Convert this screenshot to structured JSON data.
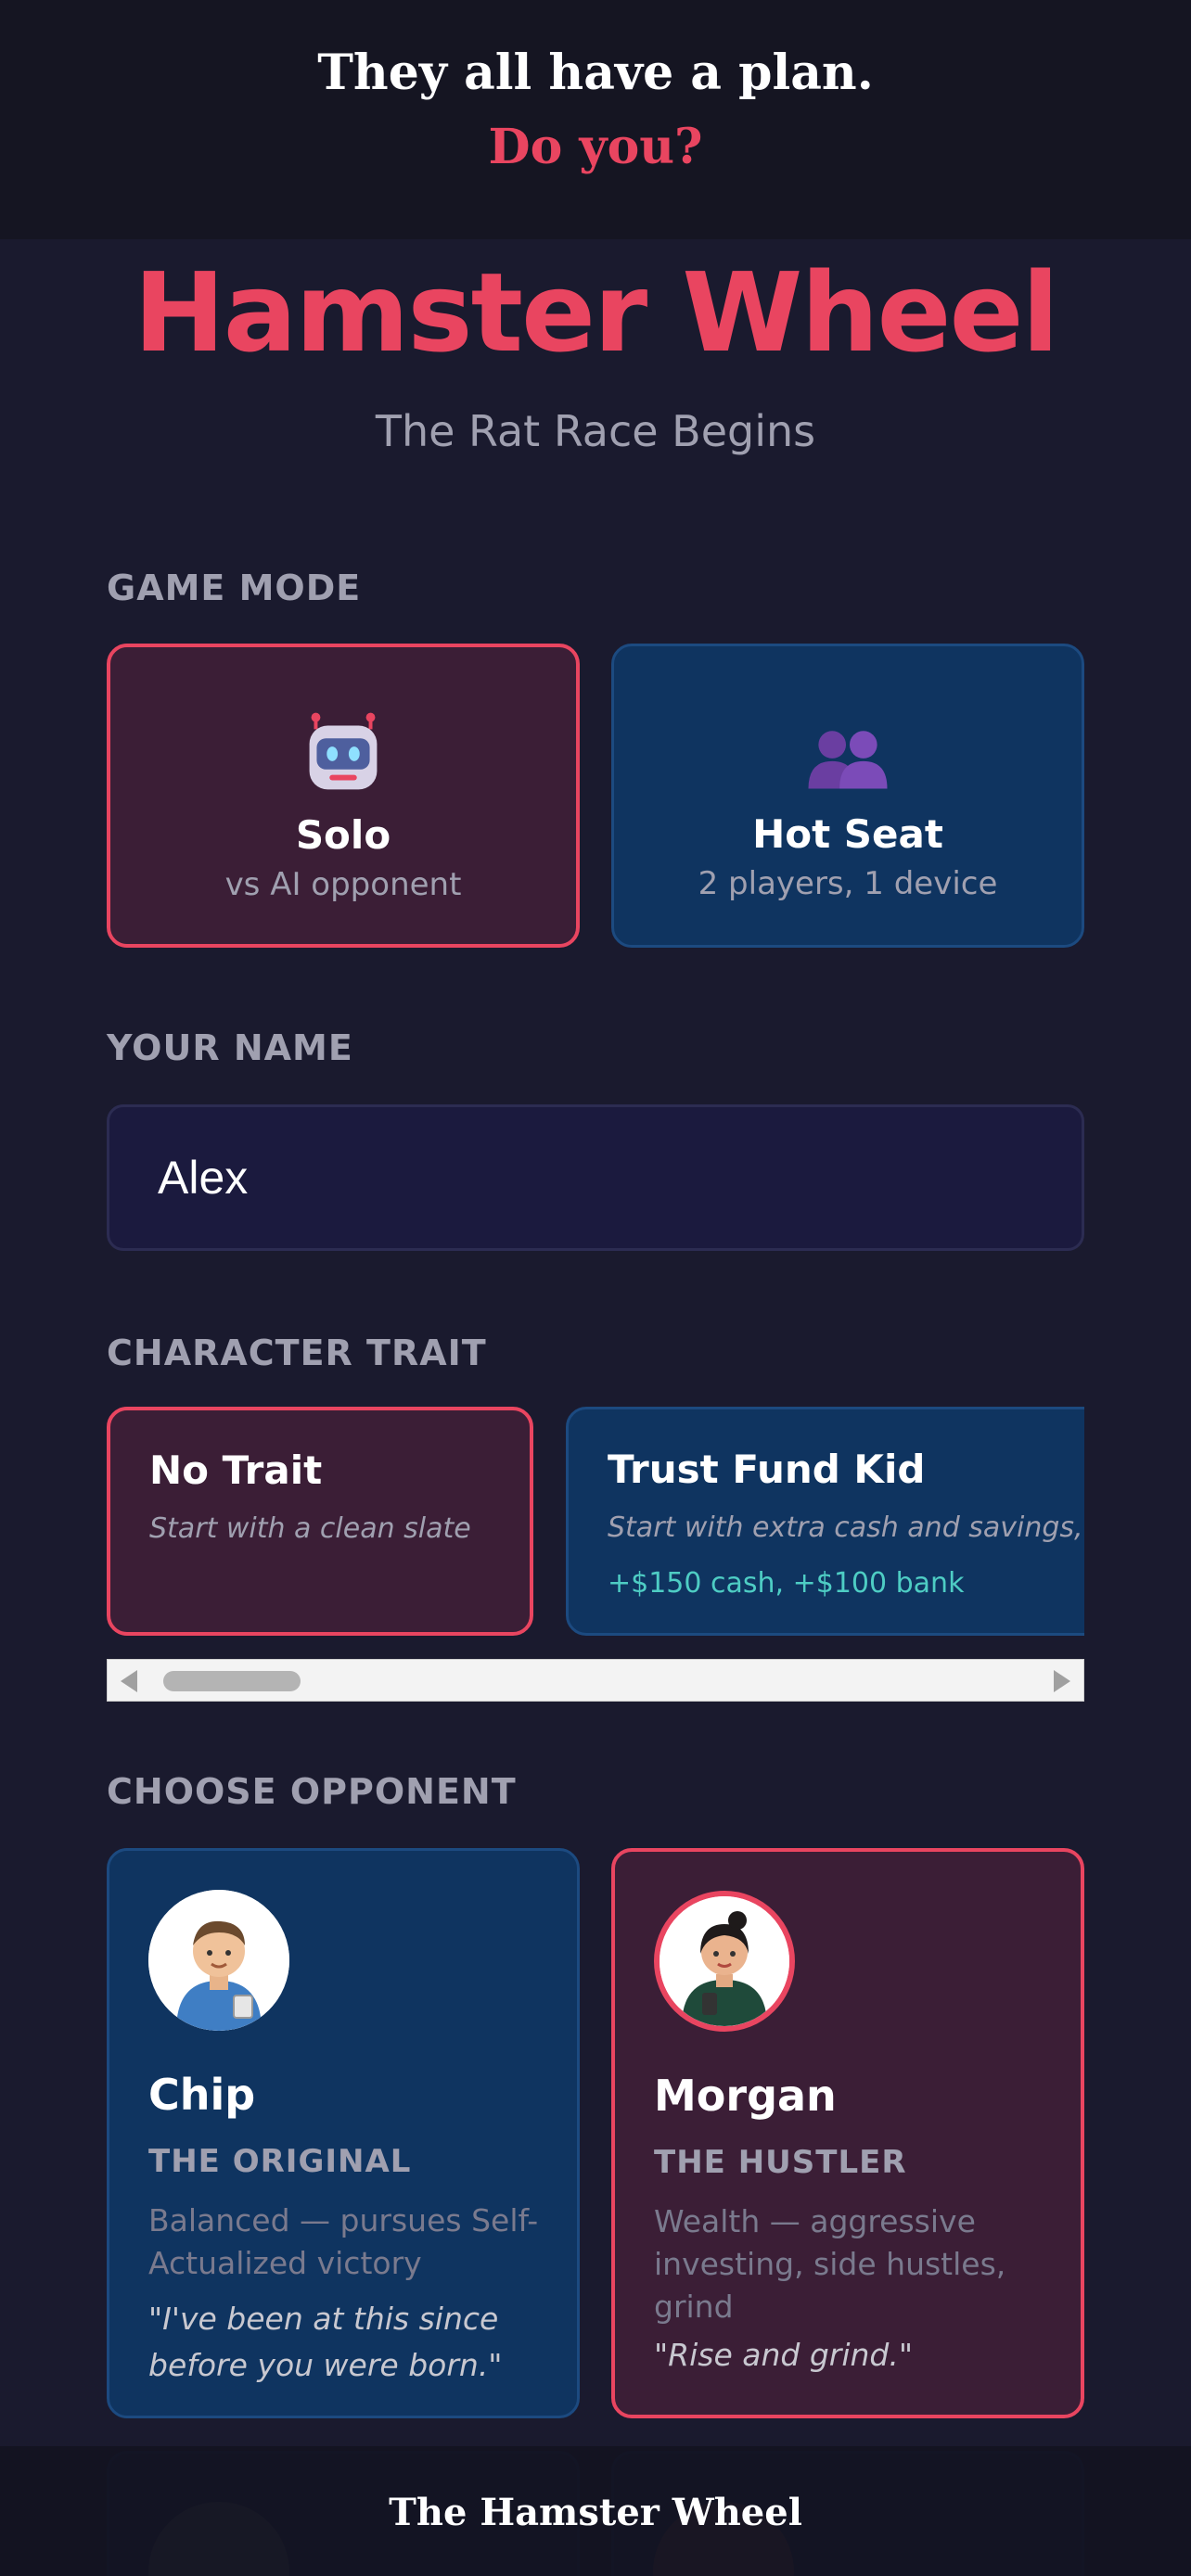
{
  "banner": {
    "line1": "They all have a plan.",
    "line2": "Do you?"
  },
  "header": {
    "title": "Hamster Wheel",
    "subtitle": "The Rat Race Begins"
  },
  "game_mode": {
    "label": "GAME MODE",
    "options": [
      {
        "name": "Solo",
        "description": "vs AI opponent",
        "icon": "robot-icon",
        "selected": true
      },
      {
        "name": "Hot Seat",
        "description": "2 players, 1 device",
        "icon": "people-icon",
        "selected": false
      }
    ]
  },
  "player_name": {
    "label": "YOUR NAME",
    "value": "Alex"
  },
  "character_trait": {
    "label": "CHARACTER TRAIT",
    "options": [
      {
        "name": "No Trait",
        "description": "Start with a clean slate",
        "bonus": "",
        "selected": true
      },
      {
        "name": "Trust Fund Kid",
        "description": "Start with extra cash and savings, bu",
        "bonus": "+$150 cash, +$100 bank",
        "selected": false
      }
    ]
  },
  "opponents": {
    "label": "CHOOSE OPPONENT",
    "options": [
      {
        "name": "Chip",
        "title": "THE ORIGINAL",
        "description": "Balanced — pursues Self-Actualized victory",
        "quote": "\"I've been at this since before you were born.\"",
        "icon": "chip-avatar",
        "selected": false
      },
      {
        "name": "Morgan",
        "title": "THE HUSTLER",
        "description": "Wealth — aggressive investing, side hustles, grind",
        "quote": "\"Rise and grind.\"",
        "icon": "morgan-avatar",
        "selected": true
      }
    ]
  },
  "footer": {
    "title": "The Hamster Wheel"
  },
  "colors": {
    "accent": "#e94560",
    "background": "#1a1a2e",
    "card": "#0f3460",
    "selected_card": "#3b1e36",
    "bonus": "#4ecdc4"
  }
}
